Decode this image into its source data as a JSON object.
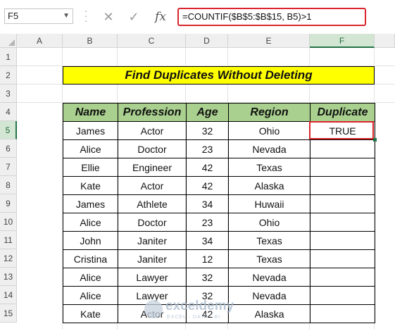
{
  "formula_bar": {
    "name_box": "F5",
    "cancel_symbol": "✕",
    "enter_symbol": "✓",
    "fx_label": "fx",
    "formula": "=COUNTIF($B$5:$B$15, B5)>1"
  },
  "columns": [
    "A",
    "B",
    "C",
    "D",
    "E",
    "F"
  ],
  "rows": [
    "1",
    "2",
    "3",
    "4",
    "5",
    "6",
    "7",
    "8",
    "9",
    "10",
    "11",
    "12",
    "13",
    "14",
    "15"
  ],
  "selected": {
    "column": "F",
    "row": "5",
    "cell": "F5"
  },
  "title": "Find Duplicates Without Deleting",
  "table": {
    "headers": [
      "Name",
      "Profession",
      "Age",
      "Region",
      "Duplicate"
    ],
    "rows": [
      [
        "James",
        "Actor",
        "32",
        "Ohio",
        "TRUE"
      ],
      [
        "Alice",
        "Doctor",
        "23",
        "Nevada",
        ""
      ],
      [
        "Ellie",
        "Engineer",
        "42",
        "Texas",
        ""
      ],
      [
        "Kate",
        "Actor",
        "42",
        "Alaska",
        ""
      ],
      [
        "James",
        "Athlete",
        "34",
        "Huwaii",
        ""
      ],
      [
        "Alice",
        "Doctor",
        "23",
        "Ohio",
        ""
      ],
      [
        "John",
        "Janiter",
        "34",
        "Texas",
        ""
      ],
      [
        "Cristina",
        "Janiter",
        "12",
        "Texas",
        ""
      ],
      [
        "Alice",
        "Lawyer",
        "32",
        "Nevada",
        ""
      ],
      [
        "Alice",
        "Lawyer",
        "32",
        "Nevada",
        ""
      ],
      [
        "Kate",
        "Actor",
        "42",
        "Alaska",
        ""
      ]
    ]
  },
  "watermark": {
    "name": "exceldemy",
    "tagline": "EXCEL · DATA · BI"
  },
  "colors": {
    "header_fill": "#a9d08e",
    "title_fill": "#ffff00",
    "highlight": "#d9262c",
    "excel_green": "#217346"
  }
}
